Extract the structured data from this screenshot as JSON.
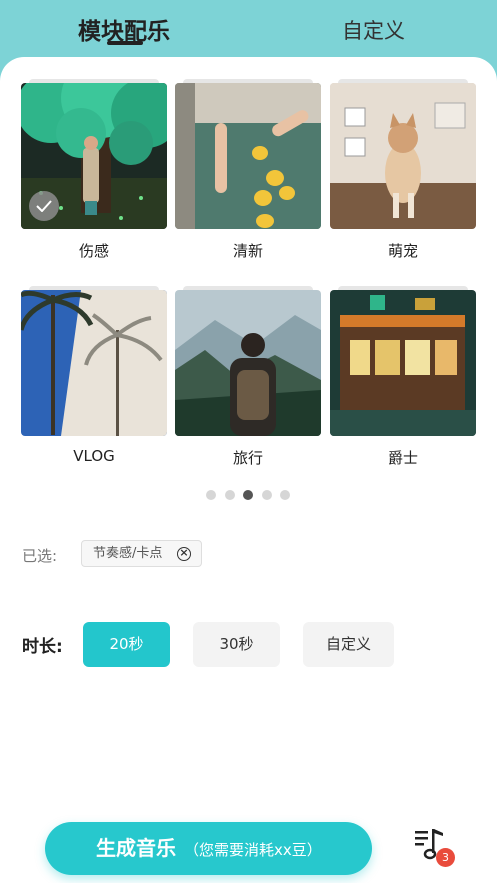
{
  "header": {
    "tabs": [
      {
        "label": "模块配乐",
        "active": true
      },
      {
        "label": "自定义",
        "active": false
      }
    ]
  },
  "templates": [
    {
      "label": "伤感",
      "selected": true,
      "image": "girl-under-tree-illustration"
    },
    {
      "label": "清新",
      "selected": false,
      "image": "lemons-in-water"
    },
    {
      "label": "萌宠",
      "selected": false,
      "image": "kitten-on-table"
    },
    {
      "label": "VLOG",
      "selected": false,
      "image": "palm-trees"
    },
    {
      "label": "旅行",
      "selected": false,
      "image": "backpacker-mountains"
    },
    {
      "label": "爵士",
      "selected": false,
      "image": "night-storefront-illustration"
    }
  ],
  "pagination": {
    "total": 5,
    "current": 3
  },
  "selection": {
    "label": "已选:",
    "chip": "节奏感/卡点"
  },
  "duration": {
    "label": "时长:",
    "options": [
      {
        "label": "20秒",
        "active": true
      },
      {
        "label": "30秒",
        "active": false
      },
      {
        "label": "自定义",
        "active": false
      }
    ]
  },
  "generate": {
    "label": "生成音乐",
    "sub": "（您需要消耗xx豆）"
  },
  "music_list": {
    "badge": "3"
  },
  "colors": {
    "accent": "#23c6cc",
    "header_bg": "#7dd3d6",
    "badge": "#e94b3c"
  }
}
